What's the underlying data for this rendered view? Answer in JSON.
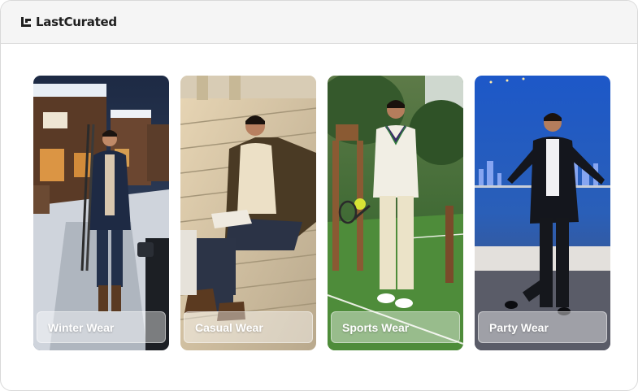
{
  "app": {
    "brand": "LastCurated"
  },
  "categories": [
    {
      "label": "Winter Wear"
    },
    {
      "label": "Casual Wear"
    },
    {
      "label": "Sports Wear"
    },
    {
      "label": "Party Wear"
    }
  ]
}
